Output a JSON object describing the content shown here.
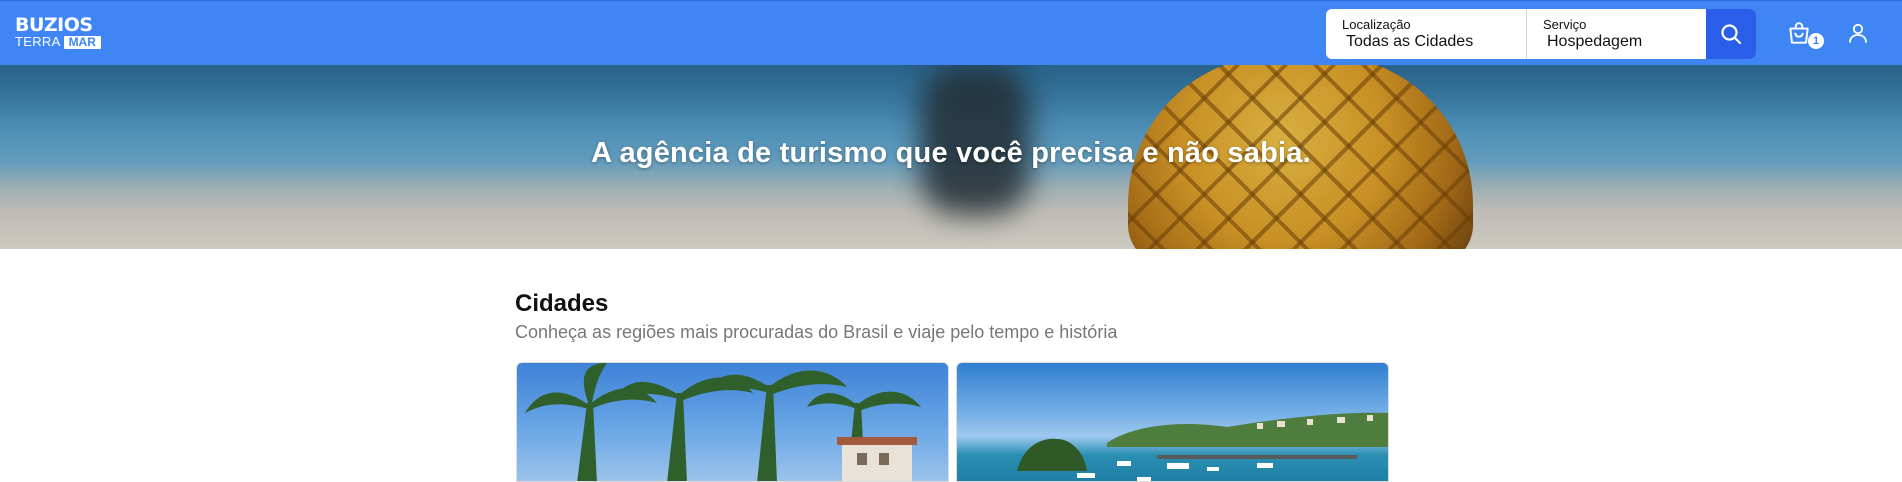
{
  "header": {
    "logo": {
      "line1": "BUZIOS",
      "line2a": "TERRA",
      "line2b": "MAR"
    },
    "search": {
      "location_label": "Localização",
      "location_value": "Todas as Cidades",
      "service_label": "Serviço",
      "service_value": "Hospedagem",
      "button_icon": "search-icon"
    },
    "cart": {
      "icon": "shopping-bag-icon",
      "count": "1"
    },
    "user": {
      "icon": "user-icon"
    },
    "colors": {
      "bar": "#3f86f4",
      "search_button": "#2a5ee8"
    }
  },
  "hero": {
    "title": "A agência de turismo que você precisa e não sabia."
  },
  "main": {
    "section": {
      "title": "Cidades",
      "subtitle": "Conheça as regiões mais procuradas do Brasil e viaje pelo tempo e história"
    }
  }
}
